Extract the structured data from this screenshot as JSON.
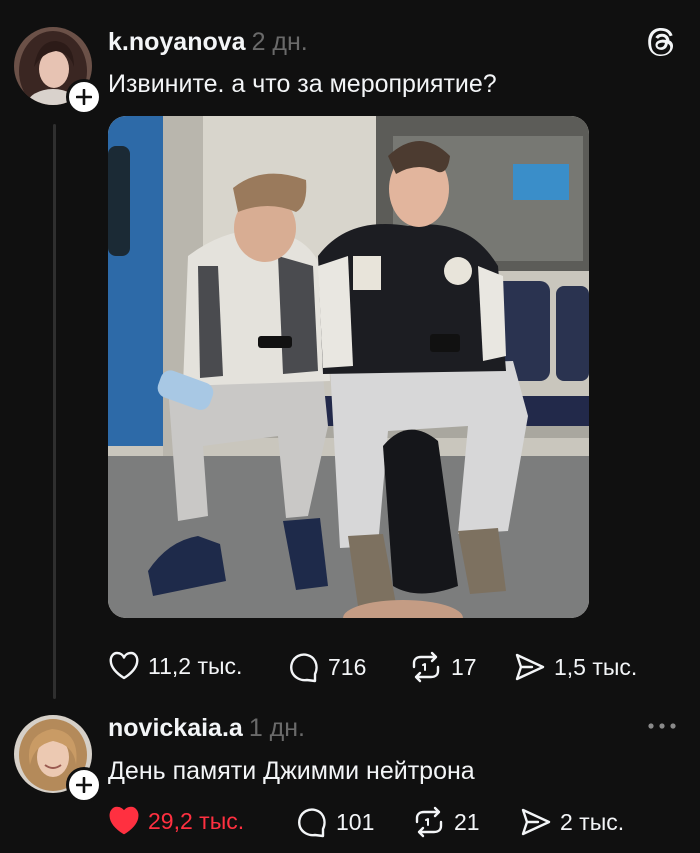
{
  "post": {
    "username": "k.noyanova",
    "time": "2 дн.",
    "text": "Извините. а что за мероприятие?",
    "image_alt": "Two young men sitting on a metro train seat looking at their phones",
    "actions": {
      "likes": "11,2 тыс.",
      "replies": "716",
      "reposts": "17",
      "shares": "1,5 тыс."
    }
  },
  "reply": {
    "username": "novickaia.a",
    "time": "1 дн.",
    "text": "День памяти Джимми нейтрона",
    "liked": true,
    "actions": {
      "likes": "29,2 тыс.",
      "replies": "101",
      "reposts": "21",
      "shares": "2 тыс."
    }
  },
  "icons": {
    "app_logo": "threads-logo-icon",
    "like": "heart-icon",
    "reply": "speech-bubble-icon",
    "repost": "repost-arrows-icon",
    "share": "paper-plane-icon",
    "more": "ellipsis-icon",
    "follow": "plus-icon"
  },
  "colors": {
    "background": "#101010",
    "text": "#f3f5f7",
    "muted": "#6a6a6a",
    "liked": "#ff3040",
    "thread_line": "#2f2f2f"
  }
}
